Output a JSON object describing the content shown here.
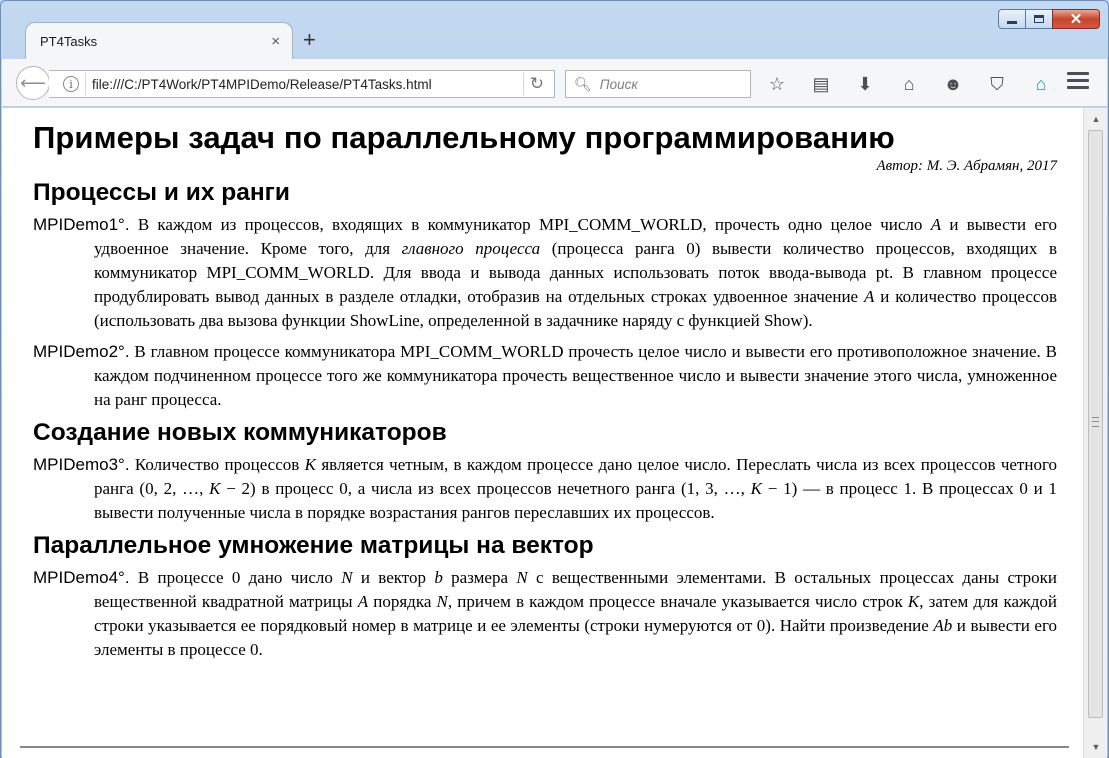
{
  "browser": {
    "tab_title": "PT4Tasks",
    "tab_close": "×",
    "new_tab": "+",
    "url": "file:///C:/PT4Work/PT4MPIDemo/Release/PT4Tasks.html",
    "search_placeholder": "Поиск",
    "icons": [
      "back-arrow-icon",
      "info-icon",
      "reload-icon",
      "search-icon",
      "star-icon",
      "reading-list-icon",
      "download-icon",
      "home-icon",
      "smiley-icon",
      "pocket-icon",
      "addon-icon",
      "hamburger-menu-icon"
    ]
  },
  "page": {
    "title": "Примеры задач по параллельному программированию",
    "author": "Автор: М. Э. Абрамян, 2017",
    "sections": [
      {
        "heading": "Процессы и их ранги",
        "tasks": [
          {
            "id": "MPIDemo1°.",
            "segments": [
              {
                "t": " В каждом из процессов, входящих в коммуникатор MPI_COMM_WORLD, прочесть одно целое число "
              },
              {
                "t": "A",
                "i": true
              },
              {
                "t": " и вывести его удвоенное значение. Кроме того, для "
              },
              {
                "t": "главного процесса",
                "i": true
              },
              {
                "t": " (процесса ранга 0) вывести количество процессов, входящих в коммуникатор MPI_COMM_WORLD. Для ввода и вывода данных использовать поток ввода-вывода pt. В главном процессе продублировать вывод данных в разделе отладки, отобразив на отдельных строках удвоенное значение "
              },
              {
                "t": "A",
                "i": true
              },
              {
                "t": " и количество процессов (использовать два вызова функции ShowLine, определенной в задачнике наряду с функцией Show)."
              }
            ]
          },
          {
            "id": "MPIDemo2°.",
            "segments": [
              {
                "t": " В главном процессе коммуникатора MPI_COMM_WORLD прочесть целое число и вывести его противоположное значение. В каждом подчиненном процессе того же коммуникатора прочесть вещественное число и вывести значение этого числа, умноженное на ранг процесса."
              }
            ]
          }
        ]
      },
      {
        "heading": "Создание новых коммуникаторов",
        "tasks": [
          {
            "id": "MPIDemo3°.",
            "segments": [
              {
                "t": " Количество процессов "
              },
              {
                "t": "K",
                "i": true
              },
              {
                "t": " является четным, в каждом процессе дано целое число. Переслать числа из всех процессов четного ранга (0, 2, …, "
              },
              {
                "t": "K",
                "i": true
              },
              {
                "t": " − 2) в процесс 0, а числа из всех процессов нечетного ранга (1, 3, …, "
              },
              {
                "t": "K",
                "i": true
              },
              {
                "t": " − 1) — в процесс 1. В процессах 0 и 1 вывести полученные числа в порядке возрастания рангов переславших их процессов."
              }
            ]
          }
        ]
      },
      {
        "heading": "Параллельное умножение матрицы на вектор",
        "tasks": [
          {
            "id": "MPIDemo4°.",
            "segments": [
              {
                "t": " В процессе 0 дано число "
              },
              {
                "t": "N",
                "i": true
              },
              {
                "t": " и вектор "
              },
              {
                "t": "b",
                "i": true
              },
              {
                "t": " размера "
              },
              {
                "t": "N",
                "i": true
              },
              {
                "t": " с вещественными элементами. В остальных процессах даны строки вещественной квадратной матрицы "
              },
              {
                "t": "A",
                "i": true
              },
              {
                "t": " порядка "
              },
              {
                "t": "N",
                "i": true
              },
              {
                "t": ", причем в каждом процессе вначале указывается число строк "
              },
              {
                "t": "K",
                "i": true
              },
              {
                "t": ", затем для каждой строки указывается ее порядковый номер в матрице и ее элементы (строки нумеруются от 0). Найти произведение "
              },
              {
                "t": "Ab",
                "i": true
              },
              {
                "t": " и вывести его элементы в процессе 0."
              }
            ]
          }
        ]
      }
    ]
  }
}
